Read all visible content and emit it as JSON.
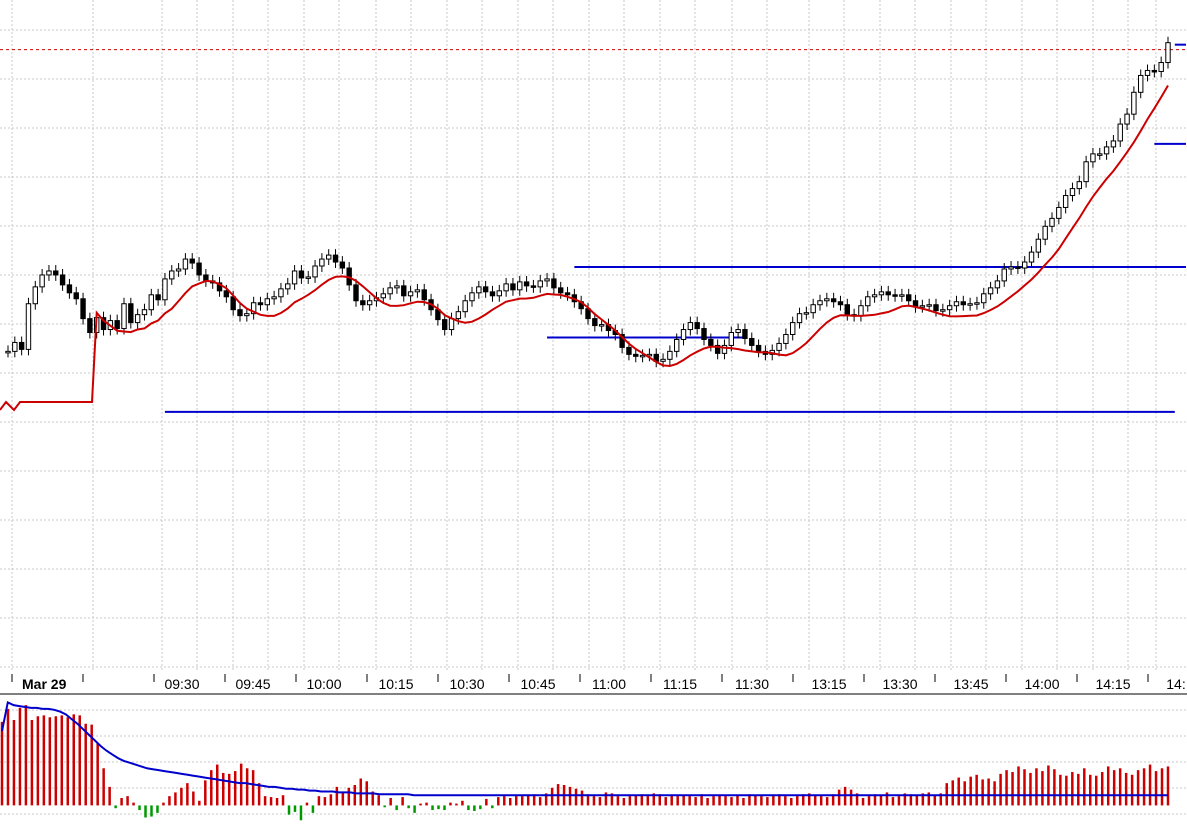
{
  "chart_data": [
    {
      "type": "candlestick",
      "panel": "price",
      "overlay_indicator_color": "#cc0000",
      "support_resistance_color": "#0000cc",
      "reference_line_color": "#cc0000",
      "reference_line_style": "dotted",
      "grid": true,
      "grid_style": "dotted",
      "ylim": [
        0,
        675
      ],
      "date_label": "Mar 29",
      "time_labels": [
        "09:30",
        "09:45",
        "10:00",
        "10:15",
        "10:30",
        "10:45",
        "11:00",
        "11:15",
        "11:30",
        "13:15",
        "13:30",
        "13:45",
        "14:00",
        "14:15",
        "14:"
      ],
      "close_series": [
        344,
        330,
        340,
        255,
        270,
        272,
        278,
        280,
        262,
        320,
        330,
        315,
        323,
        290,
        302,
        309,
        320,
        332,
        335,
        340,
        345,
        356,
        380,
        384,
        397,
        390,
        375,
        367,
        377,
        381,
        383,
        387,
        391,
        383,
        373,
        361,
        338,
        350,
        334,
        327,
        327,
        318,
        320,
        325,
        330,
        338,
        345,
        356,
        353,
        347,
        336,
        322,
        307,
        303,
        301,
        301,
        307,
        302,
        295,
        303,
        327,
        312,
        310,
        297,
        283,
        298,
        304,
        283,
        279,
        282,
        300,
        302,
        318,
        307,
        302,
        307,
        300,
        296,
        301,
        301,
        292,
        287,
        274,
        265,
        263,
        270,
        274,
        284,
        292,
        310,
        315,
        325,
        346,
        379,
        351,
        387,
        376,
        370,
        350,
        338,
        340,
        349,
        355,
        362,
        348,
        370,
        359,
        362,
        344,
        329,
        345,
        339,
        361,
        355,
        349,
        360,
        343,
        335,
        345,
        320,
        312,
        327,
        329,
        366,
        349,
        339,
        341,
        355,
        342,
        333,
        330,
        320,
        346,
        348,
        345,
        356,
        342,
        331,
        332,
        359,
        373,
        397,
        398,
        419,
        425,
        440,
        463,
        468,
        457,
        456,
        475,
        481,
        480,
        499,
        500,
        494,
        487,
        480,
        495,
        511,
        514,
        531,
        539,
        550,
        588,
        596,
        612,
        627,
        626,
        625,
        621,
        639,
        636,
        629,
        614,
        609,
        631,
        665,
        654,
        661,
        649,
        640,
        651,
        645,
        653,
        664,
        654,
        652,
        653,
        650,
        653,
        637,
        641,
        649,
        636,
        637,
        639,
        642,
        652,
        631,
        628,
        650,
        649,
        648,
        667,
        701,
        720,
        728,
        750,
        759,
        775,
        801,
        827,
        849,
        866,
        907,
        990,
        1040,
        1071,
        1084,
        1111,
        1128,
        1135,
        1149,
        1165,
        1183,
        1198,
        1203,
        1224,
        1259,
        1279,
        1279,
        1315,
        1345,
        1365,
        1385,
        1420,
        1453,
        1487,
        1515,
        1517,
        1530,
        1553,
        1581,
        1605,
        1645,
        1679,
        1686,
        1711,
        1730,
        1751,
        1773,
        1796,
        1825,
        1855,
        1884,
        1916,
        1940,
        1970,
        2000,
        2025
      ],
      "price_bars": [
        [
          0,
          321
        ],
        [
          1,
          330
        ],
        [
          2,
          323
        ],
        [
          3,
          369
        ],
        [
          4,
          386
        ],
        [
          5,
          398
        ],
        [
          6,
          402
        ],
        [
          7,
          398
        ],
        [
          8,
          388
        ],
        [
          9,
          380
        ],
        [
          10,
          374
        ],
        [
          11,
          354
        ],
        [
          12,
          340
        ],
        [
          13,
          355
        ],
        [
          14,
          343
        ],
        [
          15,
          352
        ],
        [
          16,
          344
        ],
        [
          17,
          369
        ],
        [
          18,
          350
        ],
        [
          19,
          358
        ],
        [
          20,
          363
        ],
        [
          21,
          378
        ],
        [
          22,
          373
        ],
        [
          23,
          394
        ],
        [
          24,
          402
        ],
        [
          25,
          404
        ],
        [
          26,
          414
        ],
        [
          27,
          410
        ],
        [
          28,
          398
        ],
        [
          29,
          392
        ],
        [
          30,
          390
        ],
        [
          31,
          382
        ],
        [
          32,
          376
        ],
        [
          33,
          363
        ],
        [
          34,
          357
        ],
        [
          35,
          359
        ],
        [
          36,
          370
        ],
        [
          37,
          368
        ],
        [
          38,
          374
        ],
        [
          39,
          376
        ],
        [
          40,
          384
        ],
        [
          41,
          389
        ],
        [
          42,
          402
        ],
        [
          43,
          395
        ],
        [
          44,
          396
        ],
        [
          45,
          407
        ],
        [
          46,
          414
        ],
        [
          47,
          418
        ],
        [
          48,
          411
        ],
        [
          49,
          405
        ],
        [
          50,
          388
        ],
        [
          51,
          372
        ],
        [
          52,
          368
        ],
        [
          53,
          372
        ],
        [
          54,
          375
        ],
        [
          55,
          379
        ],
        [
          56,
          385
        ],
        [
          57,
          387
        ],
        [
          58,
          377
        ],
        [
          59,
          381
        ],
        [
          60,
          383
        ],
        [
          61,
          373
        ],
        [
          62,
          363
        ],
        [
          63,
          353
        ],
        [
          64,
          343
        ],
        [
          65,
          354
        ],
        [
          66,
          361
        ],
        [
          67,
          372
        ],
        [
          68,
          380
        ],
        [
          69,
          386
        ],
        [
          70,
          381
        ],
        [
          71,
          377
        ],
        [
          72,
          382
        ],
        [
          73,
          389
        ],
        [
          74,
          383
        ],
        [
          75,
          391
        ],
        [
          76,
          387
        ],
        [
          77,
          386
        ],
        [
          78,
          392
        ],
        [
          79,
          394
        ],
        [
          80,
          385
        ],
        [
          81,
          380
        ],
        [
          82,
          378
        ],
        [
          83,
          371
        ],
        [
          84,
          364
        ],
        [
          85,
          354
        ],
        [
          86,
          347
        ],
        [
          87,
          348
        ],
        [
          88,
          342
        ],
        [
          89,
          338
        ],
        [
          90,
          325
        ],
        [
          91,
          318
        ],
        [
          92,
          316
        ],
        [
          93,
          317
        ],
        [
          94,
          318
        ],
        [
          95,
          311
        ],
        [
          96,
          313
        ],
        [
          97,
          321
        ],
        [
          98,
          333
        ],
        [
          99,
          343
        ],
        [
          100,
          350
        ],
        [
          101,
          344
        ],
        [
          102,
          333
        ],
        [
          103,
          327
        ],
        [
          104,
          319
        ],
        [
          105,
          327
        ],
        [
          106,
          340
        ],
        [
          107,
          343
        ],
        [
          108,
          334
        ],
        [
          109,
          327
        ],
        [
          110,
          321
        ],
        [
          111,
          318
        ],
        [
          112,
          322
        ],
        [
          113,
          329
        ],
        [
          114,
          338
        ],
        [
          115,
          350
        ],
        [
          116,
          359
        ],
        [
          117,
          360
        ],
        [
          118,
          368
        ],
        [
          119,
          372
        ],
        [
          120,
          374
        ],
        [
          121,
          371
        ],
        [
          122,
          368
        ],
        [
          123,
          358
        ],
        [
          124,
          357
        ],
        [
          125,
          367
        ],
        [
          126,
          376
        ],
        [
          127,
          378
        ],
        [
          128,
          381
        ],
        [
          129,
          378
        ],
        [
          130,
          377
        ],
        [
          131,
          378
        ],
        [
          132,
          372
        ],
        [
          133,
          366
        ],
        [
          134,
          367
        ],
        [
          135,
          368
        ],
        [
          136,
          362
        ],
        [
          137,
          363
        ],
        [
          138,
          367
        ],
        [
          139,
          371
        ],
        [
          140,
          368
        ],
        [
          141,
          369
        ],
        [
          142,
          370
        ],
        [
          143,
          379
        ],
        [
          144,
          385
        ],
        [
          145,
          392
        ],
        [
          146,
          404
        ],
        [
          147,
          406
        ],
        [
          148,
          405
        ],
        [
          149,
          411
        ],
        [
          150,
          421
        ],
        [
          151,
          434
        ],
        [
          152,
          447
        ],
        [
          153,
          455
        ],
        [
          154,
          466
        ],
        [
          155,
          478
        ],
        [
          156,
          485
        ],
        [
          157,
          492
        ],
        [
          158,
          512
        ],
        [
          159,
          520
        ],
        [
          160,
          520
        ],
        [
          161,
          527
        ],
        [
          162,
          533
        ],
        [
          163,
          550
        ],
        [
          164,
          560
        ],
        [
          165,
          582
        ],
        [
          166,
          599
        ],
        [
          167,
          604
        ],
        [
          168,
          603
        ],
        [
          169,
          612
        ],
        [
          170,
          632
        ]
      ],
      "levels": [
        {
          "y_value": 260,
          "x_start": 23,
          "x_end": 171
        },
        {
          "y_value": 335,
          "x_start": 79,
          "x_end": 108
        },
        {
          "y_value": 406,
          "x_start": 83,
          "x_end": 179
        },
        {
          "y_value": 530,
          "x_start": 168,
          "x_end": 191
        },
        {
          "y_value": 630,
          "x_start": 171,
          "x_end": 196
        }
      ],
      "reference_line_value": 625
    },
    {
      "type": "bar",
      "panel": "volume",
      "positive_color": "#cc0000",
      "negative_color": "#009900",
      "average_line_color": "#0000cc",
      "grid": true,
      "ylim": [
        -20,
        120
      ],
      "values": [
        90,
        104,
        92,
        105,
        108,
        92,
        96,
        97,
        95,
        96,
        97,
        95,
        98,
        97,
        88,
        87,
        67,
        40,
        20,
        -3,
        8,
        10,
        3,
        -5,
        -13,
        -12,
        -8,
        3,
        10,
        14,
        19,
        24,
        15,
        5,
        27,
        38,
        44,
        35,
        34,
        37,
        45,
        40,
        38,
        24,
        10,
        9,
        8,
        11,
        -10,
        -7,
        -16,
        3,
        -8,
        10,
        9,
        12,
        20,
        14,
        19,
        22,
        29,
        26,
        15,
        11,
        -2,
        8,
        -5,
        9,
        -3,
        -8,
        2,
        3,
        -5,
        -4,
        -5,
        3,
        2,
        5,
        -5,
        -6,
        -4,
        7,
        -3,
        9,
        10,
        8,
        10,
        10,
        11,
        12,
        9,
        13,
        19,
        23,
        22,
        20,
        18,
        16,
        12,
        10,
        9,
        14,
        13,
        10,
        8,
        10,
        11,
        12,
        10,
        13,
        12,
        9,
        11,
        10,
        11,
        10,
        9,
        12,
        8,
        10,
        11,
        10,
        9,
        11,
        8,
        12,
        11,
        10,
        9,
        11,
        12,
        10,
        8,
        10,
        12,
        13,
        11,
        10,
        9,
        12,
        17,
        20,
        17,
        13,
        8,
        10,
        12,
        11,
        14,
        9,
        10,
        13,
        12,
        11,
        13,
        14,
        11,
        13,
        24,
        27,
        30,
        26,
        31,
        33,
        28,
        29,
        26,
        34,
        38,
        36,
        42,
        39,
        35,
        40,
        37,
        43,
        39,
        33,
        32,
        36,
        34,
        40,
        33,
        32,
        36,
        42,
        38,
        40,
        35,
        33,
        38,
        40,
        44,
        37,
        40,
        42
      ],
      "average": [
        80,
        111,
        108,
        107,
        106,
        105,
        105,
        104,
        104,
        103,
        101,
        98,
        93,
        88,
        82,
        76,
        70,
        64,
        59,
        55,
        51,
        48,
        46,
        44,
        42,
        40,
        39,
        38,
        37,
        36,
        35,
        34,
        33,
        32,
        31,
        30,
        29,
        28,
        27,
        26,
        25,
        24,
        24,
        23,
        22,
        21,
        20,
        20,
        19,
        18,
        18,
        17,
        17,
        16,
        16,
        15,
        15,
        15,
        14,
        14,
        14,
        13,
        13,
        13,
        13,
        12,
        12,
        12,
        12,
        12,
        12,
        11,
        11,
        11,
        11,
        11,
        11,
        11,
        11,
        11,
        11,
        11,
        11,
        11,
        11,
        11,
        11,
        11,
        11,
        11,
        11,
        11,
        11,
        11,
        11,
        11,
        11,
        11,
        11,
        11,
        11,
        11,
        11,
        11,
        11,
        11,
        11,
        11,
        11,
        11,
        11,
        11,
        11,
        11,
        11,
        11,
        11,
        11,
        11,
        11,
        11,
        11,
        11,
        11,
        11,
        11,
        11,
        11,
        11,
        11,
        11,
        11,
        11,
        11,
        11,
        11,
        11,
        11,
        11,
        11,
        11,
        11,
        11,
        11,
        11,
        11,
        11,
        11,
        11,
        11,
        11,
        11,
        11,
        11,
        11,
        11,
        11,
        11,
        11,
        11,
        11,
        11,
        11,
        11,
        11,
        11,
        11,
        11,
        11,
        11,
        11,
        11,
        11,
        11,
        11,
        11,
        11,
        11,
        11,
        11,
        11,
        11,
        11,
        11,
        11,
        11,
        11,
        11,
        11,
        11,
        11,
        11,
        11,
        11,
        11,
        11,
        11,
        11,
        11,
        11,
        11,
        11
      ]
    }
  ]
}
